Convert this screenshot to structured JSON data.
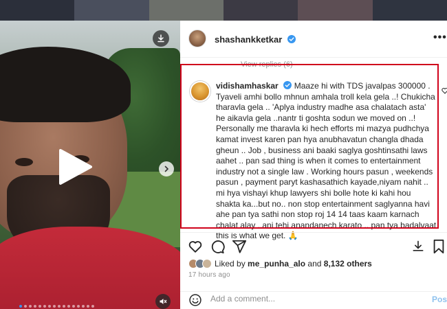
{
  "post": {
    "author": "shashankketkar",
    "more_label": "•••",
    "view_replies": "View replies (6)"
  },
  "comment": {
    "author": "vidishamhaskar",
    "text": "Maaze hi with TDS javalpas 300000 . Tyaveli amhi bollo mhnun amhala troll kela gela ..! Chukicha tharavla gela .. 'Aplya industry madhe asa chalatach asta' he aikavla gela ..nantr ti goshta sodun we moved on ..! Personally me tharavla ki hech efforts mi mazya pudhchya kamat invest karen pan hya anubhavatun changla dhada gheun .. Job , business ani baaki saglya goshtinsathi laws aahet .. pan sad thing is when it comes to entertainment industry not a single law . Working hours pasun , weekends pasun , payment paryt kashasathich kayade,niyam nahit .. mi hya vishayi khup lawyers shi bolle hote ki kahi hou shakta ka...but no.. non stop entertainment saglyanna havi ahe pan tya sathi non stop roj 14 14 taas kaam karnach chalat alay ..ani tehi anandanech karato .. pan tya badalvaat this is what we get. 🙏"
  },
  "likes": {
    "prefix": "Liked by",
    "user": "me_punha_alo",
    "conjunction": "and",
    "count": "8,132 others"
  },
  "timestamp": "17 hours ago",
  "add_comment": {
    "placeholder": "Add a comment...",
    "post_label": "Post"
  },
  "icons": {
    "download": "download-icon",
    "play": "play-icon",
    "next": "chevron-right-icon",
    "mute": "speaker-muted-icon",
    "verified": "verified-badge-icon",
    "like": "heart-icon",
    "comment": "comment-icon",
    "share": "paper-plane-icon",
    "save": "bookmark-icon",
    "emoji": "emoji-icon",
    "more": "more-options-icon"
  },
  "colors": {
    "highlight": "#d0021b",
    "verified": "#3897f0",
    "post_button": "#8fc2ee"
  },
  "carousel": {
    "total": 16,
    "active": 1
  }
}
